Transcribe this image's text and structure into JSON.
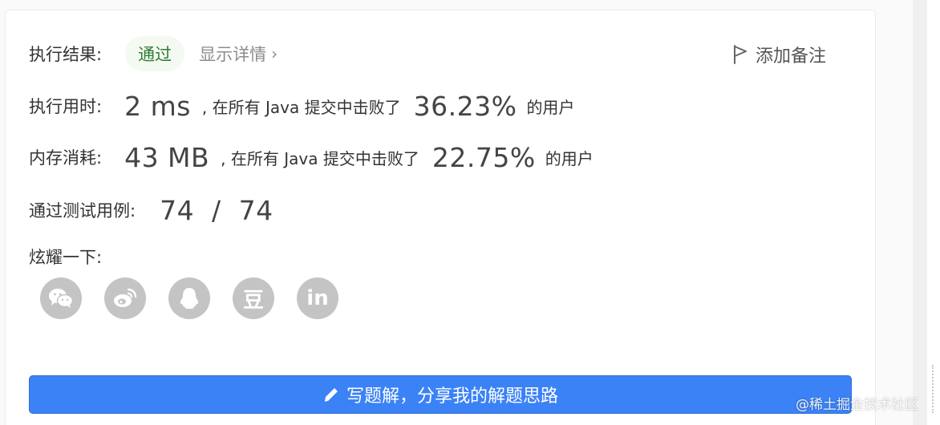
{
  "result": {
    "label": "执行结果:",
    "status": "通过",
    "details_link": "显示详情",
    "details_chevron": "›",
    "add_note": "添加备注",
    "status_color": "#2e7d32",
    "badge_bg": "#f4faf2"
  },
  "runtime": {
    "label": "执行用时:",
    "value": "2 ms",
    "text": ", 在所有 Java 提交中击败了",
    "percent": "36.23%",
    "suffix": "的用户"
  },
  "memory": {
    "label": "内存消耗:",
    "value": "43 MB",
    "text": ", 在所有 Java 提交中击败了",
    "percent": "22.75%",
    "suffix": "的用户"
  },
  "testcases": {
    "label": "通过测试用例:",
    "value": "74  /  74"
  },
  "share": {
    "label": "炫耀一下:",
    "icons": [
      "wechat-icon",
      "weibo-icon",
      "qq-icon",
      "douban-icon",
      "linkedin-icon"
    ],
    "douban_glyph": "豆",
    "linkedin_glyph": "in"
  },
  "write_solution": {
    "label": "写题解，分享我的解题思路",
    "color": "#3b82f6"
  },
  "watermark": "@稀土掘金技术社区"
}
